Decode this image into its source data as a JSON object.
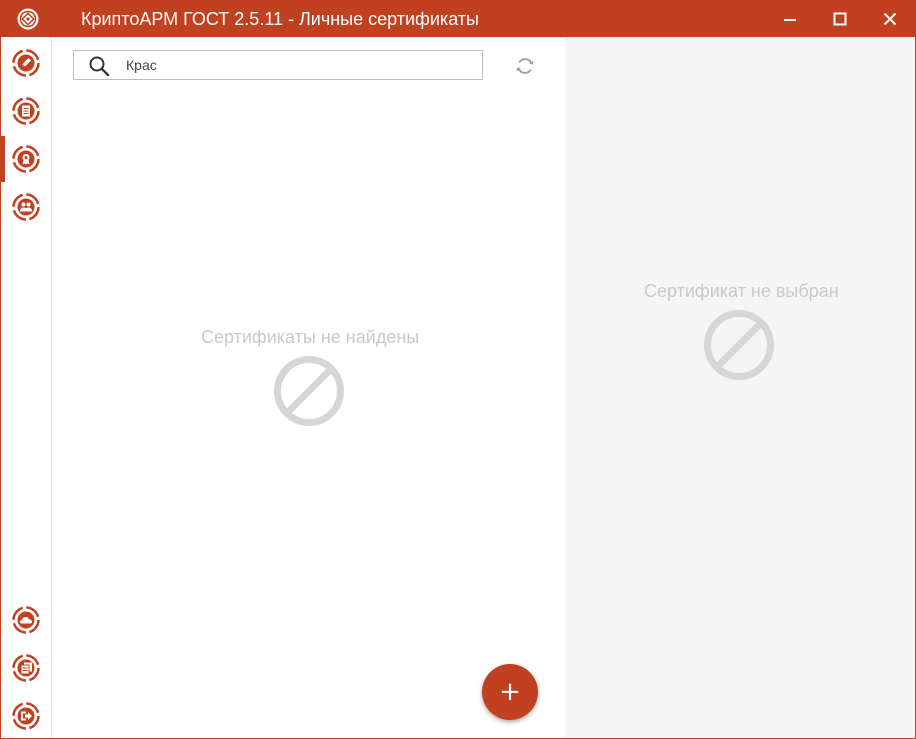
{
  "window": {
    "title": "КриптоАРМ ГОСТ 2.5.11 - Личные сертификаты",
    "accent_color": "#c1401f",
    "controls": [
      "minimize-icon",
      "maximize-icon",
      "close-icon"
    ]
  },
  "sidebar": {
    "top_items": [
      {
        "icon": "pen-sign-icon",
        "active": false
      },
      {
        "icon": "document-icon",
        "active": false
      },
      {
        "icon": "certificate-icon",
        "active": true
      },
      {
        "icon": "contacts-icon",
        "active": false
      }
    ],
    "bottom_items": [
      {
        "icon": "cloud-icon"
      },
      {
        "icon": "documents-stack-icon"
      },
      {
        "icon": "exit-icon"
      }
    ]
  },
  "search": {
    "value": "Крас",
    "icon": "search-icon"
  },
  "list": {
    "empty_message": "Сертификаты не найдены",
    "empty_icon": "no-entry-icon"
  },
  "details": {
    "empty_message": "Сертификат не выбран",
    "empty_icon": "no-entry-icon"
  },
  "fab": {
    "label": "+",
    "icon": "add-icon"
  }
}
